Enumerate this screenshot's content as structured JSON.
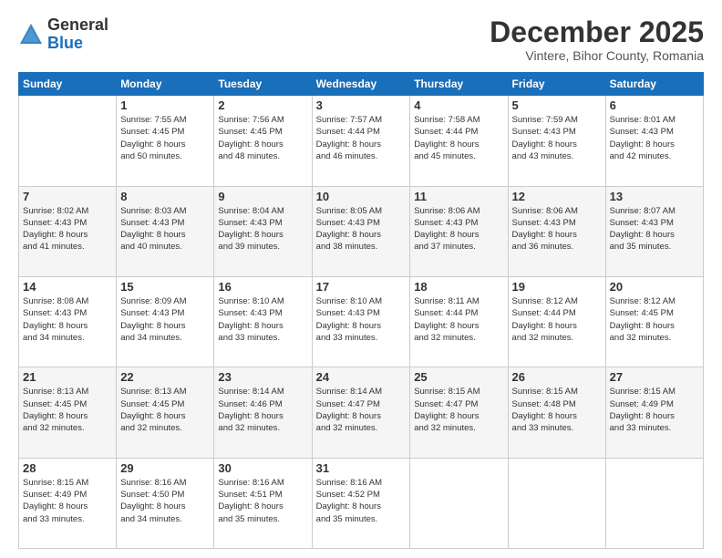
{
  "header": {
    "logo": {
      "general": "General",
      "blue": "Blue"
    },
    "title": "December 2025",
    "subtitle": "Vintere, Bihor County, Romania"
  },
  "calendar": {
    "weekdays": [
      "Sunday",
      "Monday",
      "Tuesday",
      "Wednesday",
      "Thursday",
      "Friday",
      "Saturday"
    ],
    "weeks": [
      [
        {
          "day": "",
          "info": ""
        },
        {
          "day": "1",
          "info": "Sunrise: 7:55 AM\nSunset: 4:45 PM\nDaylight: 8 hours\nand 50 minutes."
        },
        {
          "day": "2",
          "info": "Sunrise: 7:56 AM\nSunset: 4:45 PM\nDaylight: 8 hours\nand 48 minutes."
        },
        {
          "day": "3",
          "info": "Sunrise: 7:57 AM\nSunset: 4:44 PM\nDaylight: 8 hours\nand 46 minutes."
        },
        {
          "day": "4",
          "info": "Sunrise: 7:58 AM\nSunset: 4:44 PM\nDaylight: 8 hours\nand 45 minutes."
        },
        {
          "day": "5",
          "info": "Sunrise: 7:59 AM\nSunset: 4:43 PM\nDaylight: 8 hours\nand 43 minutes."
        },
        {
          "day": "6",
          "info": "Sunrise: 8:01 AM\nSunset: 4:43 PM\nDaylight: 8 hours\nand 42 minutes."
        }
      ],
      [
        {
          "day": "7",
          "info": "Sunrise: 8:02 AM\nSunset: 4:43 PM\nDaylight: 8 hours\nand 41 minutes."
        },
        {
          "day": "8",
          "info": "Sunrise: 8:03 AM\nSunset: 4:43 PM\nDaylight: 8 hours\nand 40 minutes."
        },
        {
          "day": "9",
          "info": "Sunrise: 8:04 AM\nSunset: 4:43 PM\nDaylight: 8 hours\nand 39 minutes."
        },
        {
          "day": "10",
          "info": "Sunrise: 8:05 AM\nSunset: 4:43 PM\nDaylight: 8 hours\nand 38 minutes."
        },
        {
          "day": "11",
          "info": "Sunrise: 8:06 AM\nSunset: 4:43 PM\nDaylight: 8 hours\nand 37 minutes."
        },
        {
          "day": "12",
          "info": "Sunrise: 8:06 AM\nSunset: 4:43 PM\nDaylight: 8 hours\nand 36 minutes."
        },
        {
          "day": "13",
          "info": "Sunrise: 8:07 AM\nSunset: 4:43 PM\nDaylight: 8 hours\nand 35 minutes."
        }
      ],
      [
        {
          "day": "14",
          "info": "Sunrise: 8:08 AM\nSunset: 4:43 PM\nDaylight: 8 hours\nand 34 minutes."
        },
        {
          "day": "15",
          "info": "Sunrise: 8:09 AM\nSunset: 4:43 PM\nDaylight: 8 hours\nand 34 minutes."
        },
        {
          "day": "16",
          "info": "Sunrise: 8:10 AM\nSunset: 4:43 PM\nDaylight: 8 hours\nand 33 minutes."
        },
        {
          "day": "17",
          "info": "Sunrise: 8:10 AM\nSunset: 4:43 PM\nDaylight: 8 hours\nand 33 minutes."
        },
        {
          "day": "18",
          "info": "Sunrise: 8:11 AM\nSunset: 4:44 PM\nDaylight: 8 hours\nand 32 minutes."
        },
        {
          "day": "19",
          "info": "Sunrise: 8:12 AM\nSunset: 4:44 PM\nDaylight: 8 hours\nand 32 minutes."
        },
        {
          "day": "20",
          "info": "Sunrise: 8:12 AM\nSunset: 4:45 PM\nDaylight: 8 hours\nand 32 minutes."
        }
      ],
      [
        {
          "day": "21",
          "info": "Sunrise: 8:13 AM\nSunset: 4:45 PM\nDaylight: 8 hours\nand 32 minutes."
        },
        {
          "day": "22",
          "info": "Sunrise: 8:13 AM\nSunset: 4:45 PM\nDaylight: 8 hours\nand 32 minutes."
        },
        {
          "day": "23",
          "info": "Sunrise: 8:14 AM\nSunset: 4:46 PM\nDaylight: 8 hours\nand 32 minutes."
        },
        {
          "day": "24",
          "info": "Sunrise: 8:14 AM\nSunset: 4:47 PM\nDaylight: 8 hours\nand 32 minutes."
        },
        {
          "day": "25",
          "info": "Sunrise: 8:15 AM\nSunset: 4:47 PM\nDaylight: 8 hours\nand 32 minutes."
        },
        {
          "day": "26",
          "info": "Sunrise: 8:15 AM\nSunset: 4:48 PM\nDaylight: 8 hours\nand 33 minutes."
        },
        {
          "day": "27",
          "info": "Sunrise: 8:15 AM\nSunset: 4:49 PM\nDaylight: 8 hours\nand 33 minutes."
        }
      ],
      [
        {
          "day": "28",
          "info": "Sunrise: 8:15 AM\nSunset: 4:49 PM\nDaylight: 8 hours\nand 33 minutes."
        },
        {
          "day": "29",
          "info": "Sunrise: 8:16 AM\nSunset: 4:50 PM\nDaylight: 8 hours\nand 34 minutes."
        },
        {
          "day": "30",
          "info": "Sunrise: 8:16 AM\nSunset: 4:51 PM\nDaylight: 8 hours\nand 35 minutes."
        },
        {
          "day": "31",
          "info": "Sunrise: 8:16 AM\nSunset: 4:52 PM\nDaylight: 8 hours\nand 35 minutes."
        },
        {
          "day": "",
          "info": ""
        },
        {
          "day": "",
          "info": ""
        },
        {
          "day": "",
          "info": ""
        }
      ]
    ]
  }
}
